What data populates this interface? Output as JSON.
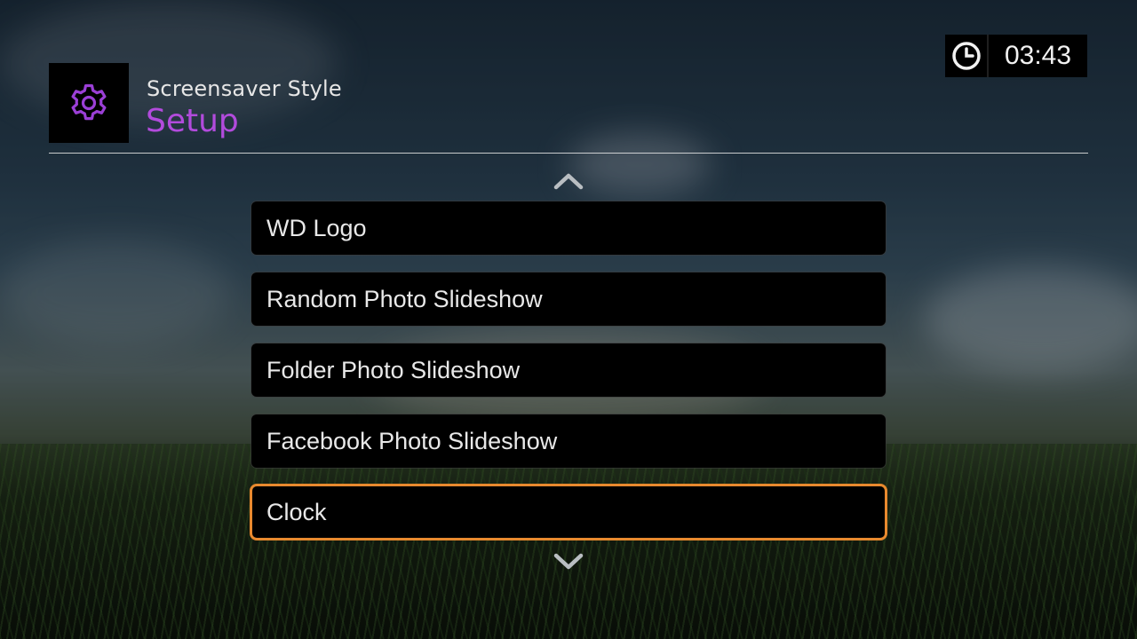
{
  "header": {
    "subtitle": "Screensaver Style",
    "title": "Setup",
    "icon": "gear-icon",
    "title_color": "#b24bdc"
  },
  "clock": {
    "icon": "clock-icon",
    "time": "03:43"
  },
  "menu": {
    "items": [
      {
        "label": "WD Logo",
        "selected": false
      },
      {
        "label": "Random Photo Slideshow",
        "selected": false
      },
      {
        "label": "Folder Photo Slideshow",
        "selected": false
      },
      {
        "label": "Facebook Photo Slideshow",
        "selected": false
      },
      {
        "label": "Clock",
        "selected": true
      }
    ],
    "selection_color": "#e8892e",
    "scroll_up_icon": "chevron-up-icon",
    "scroll_down_icon": "chevron-down-icon"
  }
}
